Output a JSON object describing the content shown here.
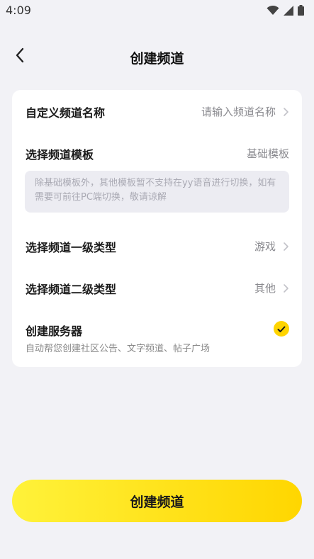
{
  "status_bar": {
    "time": "4:09",
    "icons": [
      "wifi-icon",
      "signal-icon",
      "battery-icon"
    ]
  },
  "nav": {
    "back_icon": "chevron-left-icon",
    "title": "创建频道"
  },
  "form": {
    "channel_name": {
      "label": "自定义频道名称",
      "placeholder": "请输入频道名称"
    },
    "template": {
      "label": "选择频道模板",
      "value": "基础模板",
      "hint": "除基础模板外，其他模板暂不支持在yy语音进行切换，如有需要可前往PC端切换，敬请谅解"
    },
    "primary_type": {
      "label": "选择频道一级类型",
      "value": "游戏"
    },
    "secondary_type": {
      "label": "选择频道二级类型",
      "value": "其他"
    },
    "create_server": {
      "label": "创建服务器",
      "description": "自动帮您创建社区公告、文字频道、帖子广场",
      "checked": true
    }
  },
  "submit": {
    "label": "创建频道"
  },
  "colors": {
    "accent": "#ffd400",
    "background": "#f2f2f6",
    "card": "#ffffff",
    "muted_text": "#8a8a8f"
  }
}
